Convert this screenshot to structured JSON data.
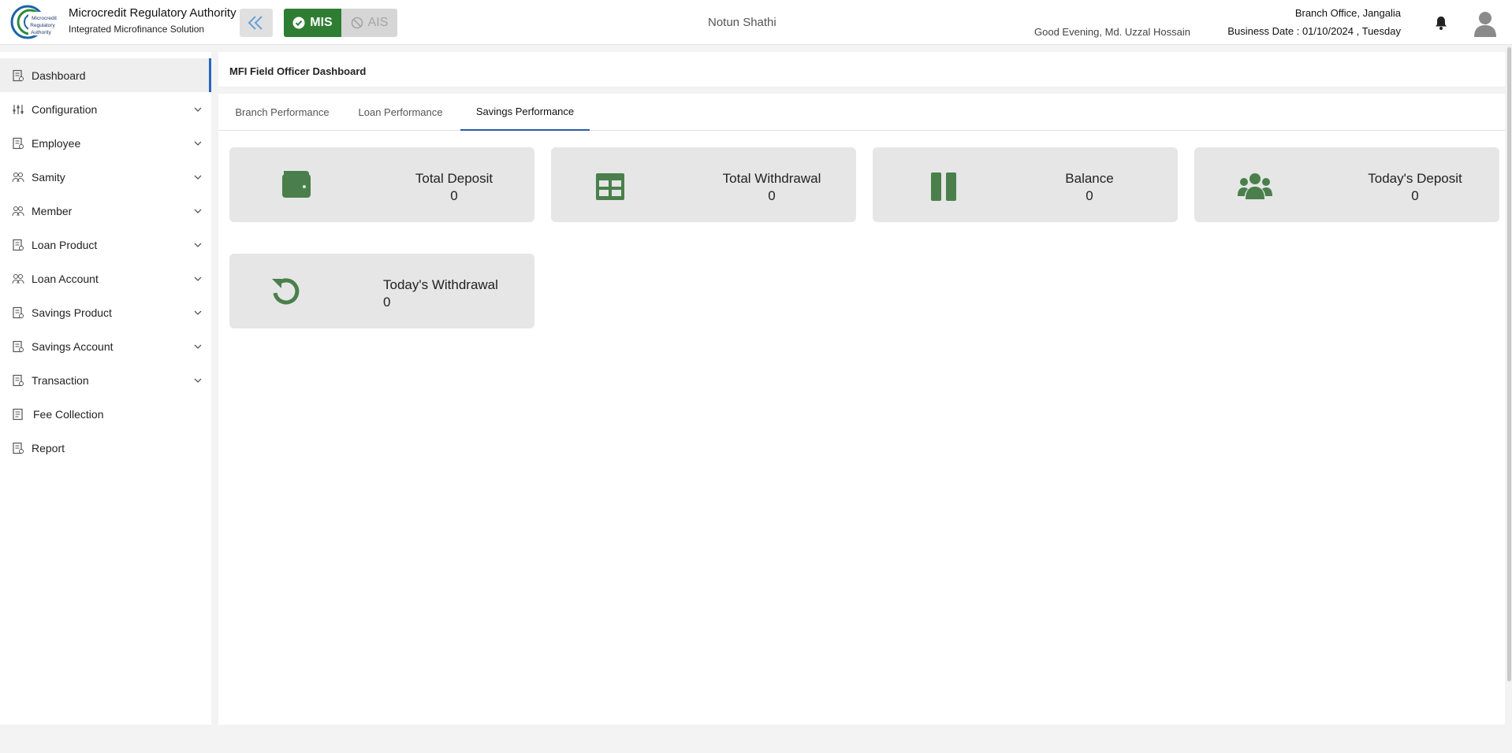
{
  "header": {
    "org_name": "Microcredit Regulatory Authority",
    "org_sub": "Integrated Microfinance Solution",
    "logo_text": "Microcredit Regulatory Authority",
    "mis_label": "MIS",
    "ais_label": "AIS",
    "center_title": "Notun Shathi",
    "greeting": "Good Evening, Md. Uzzal Hossain",
    "branch": "Branch Office, Jangalia",
    "business_date": "Business Date : 01/10/2024 , Tuesday"
  },
  "sidebar": {
    "items": [
      {
        "label": "Dashboard",
        "icon": "document-icon",
        "expandable": false,
        "active": true
      },
      {
        "label": "Configuration",
        "icon": "sliders-icon",
        "expandable": true
      },
      {
        "label": "Employee",
        "icon": "document-icon",
        "expandable": true
      },
      {
        "label": "Samity",
        "icon": "group-icon",
        "expandable": true
      },
      {
        "label": "Member",
        "icon": "group-icon",
        "expandable": true
      },
      {
        "label": "Loan Product",
        "icon": "document-icon",
        "expandable": true
      },
      {
        "label": "Loan Account",
        "icon": "group-icon",
        "expandable": true
      },
      {
        "label": "Savings Product",
        "icon": "document-icon",
        "expandable": true
      },
      {
        "label": "Savings Account",
        "icon": "document-icon",
        "expandable": true
      },
      {
        "label": "Transaction",
        "icon": "document-icon",
        "expandable": true
      },
      {
        "label": "Fee Collection",
        "icon": "receipt-icon",
        "expandable": false
      },
      {
        "label": "Report",
        "icon": "document-icon",
        "expandable": false
      }
    ]
  },
  "main": {
    "page_title": "MFI Field Officer Dashboard",
    "tabs": [
      {
        "label": "Branch Performance"
      },
      {
        "label": "Loan Performance"
      },
      {
        "label": "Savings Performance",
        "active": true
      }
    ],
    "cards": [
      {
        "title": "Total Deposit",
        "value": "0",
        "icon": "wallet-icon"
      },
      {
        "title": "Total Withdrawal",
        "value": "0",
        "icon": "table-icon"
      },
      {
        "title": "Balance",
        "value": "0",
        "icon": "pause-icon"
      },
      {
        "title": "Today's Deposit",
        "value": "0",
        "icon": "people-icon"
      },
      {
        "title": "Today's Withdrawal",
        "value": "0",
        "icon": "refresh-icon"
      }
    ]
  },
  "colors": {
    "accent_green": "#2e7d32",
    "card_icon_green": "#4a7f4c",
    "active_blue": "#2a65c0",
    "card_bg": "#e5e6e5"
  }
}
